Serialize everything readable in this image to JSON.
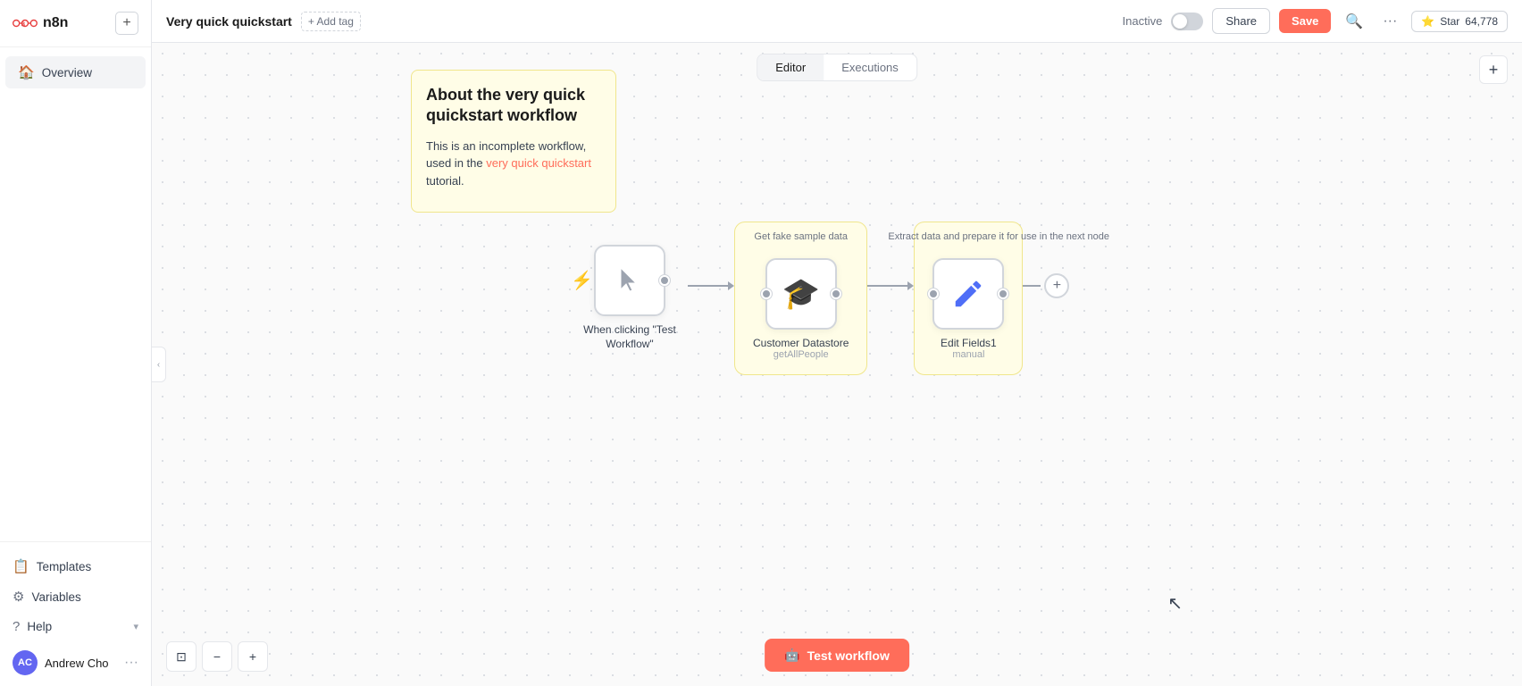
{
  "sidebar": {
    "logo_text": "n8n",
    "add_btn_label": "+",
    "nav_items": [
      {
        "id": "overview",
        "label": "Overview",
        "icon": "🏠",
        "active": true
      }
    ],
    "footer_items": [
      {
        "id": "templates",
        "label": "Templates",
        "icon": "📋"
      },
      {
        "id": "variables",
        "label": "Variables",
        "icon": "⚙"
      },
      {
        "id": "help",
        "label": "Help",
        "icon": "?"
      }
    ],
    "user": {
      "name": "Andrew Cho",
      "initials": "AC",
      "more_icon": "···"
    }
  },
  "topbar": {
    "workflow_title": "Very quick quickstart",
    "add_tag_label": "+ Add tag",
    "inactive_label": "Inactive",
    "share_label": "Share",
    "save_label": "Save",
    "more_icon": "···",
    "github_star_label": "Star",
    "github_star_count": "64,778"
  },
  "tabs": [
    {
      "id": "editor",
      "label": "Editor",
      "active": true
    },
    {
      "id": "executions",
      "label": "Executions",
      "active": false
    }
  ],
  "canvas": {
    "info_card": {
      "title": "About the very quick quickstart workflow",
      "body": "This is an incomplete workflow, used in the ",
      "link_text": "very quick quickstart",
      "body_suffix": " tutorial."
    },
    "node_group_1": {
      "label_top": "Get fake sample data",
      "node": {
        "id": "customer-datastore",
        "label": "Customer Datastore",
        "sublabel": "getAllPeople",
        "icon": "🎓"
      }
    },
    "node_group_2": {
      "label_top": "Extract data and prepare it for use in the next node",
      "node": {
        "id": "edit-fields1",
        "label": "Edit Fields1",
        "sublabel": "manual",
        "icon": "✏️"
      }
    },
    "trigger_node": {
      "label": "When clicking \"Test Workflow\"",
      "icon": "▶"
    },
    "add_node_label": "+",
    "add_end_label": "+"
  },
  "toolbar": {
    "fit_icon": "⊡",
    "zoom_in_icon": "＋",
    "zoom_out_icon": "－"
  },
  "test_workflow_btn": "Test workflow",
  "collapse_icon": "‹",
  "add_corner_icon": "+"
}
